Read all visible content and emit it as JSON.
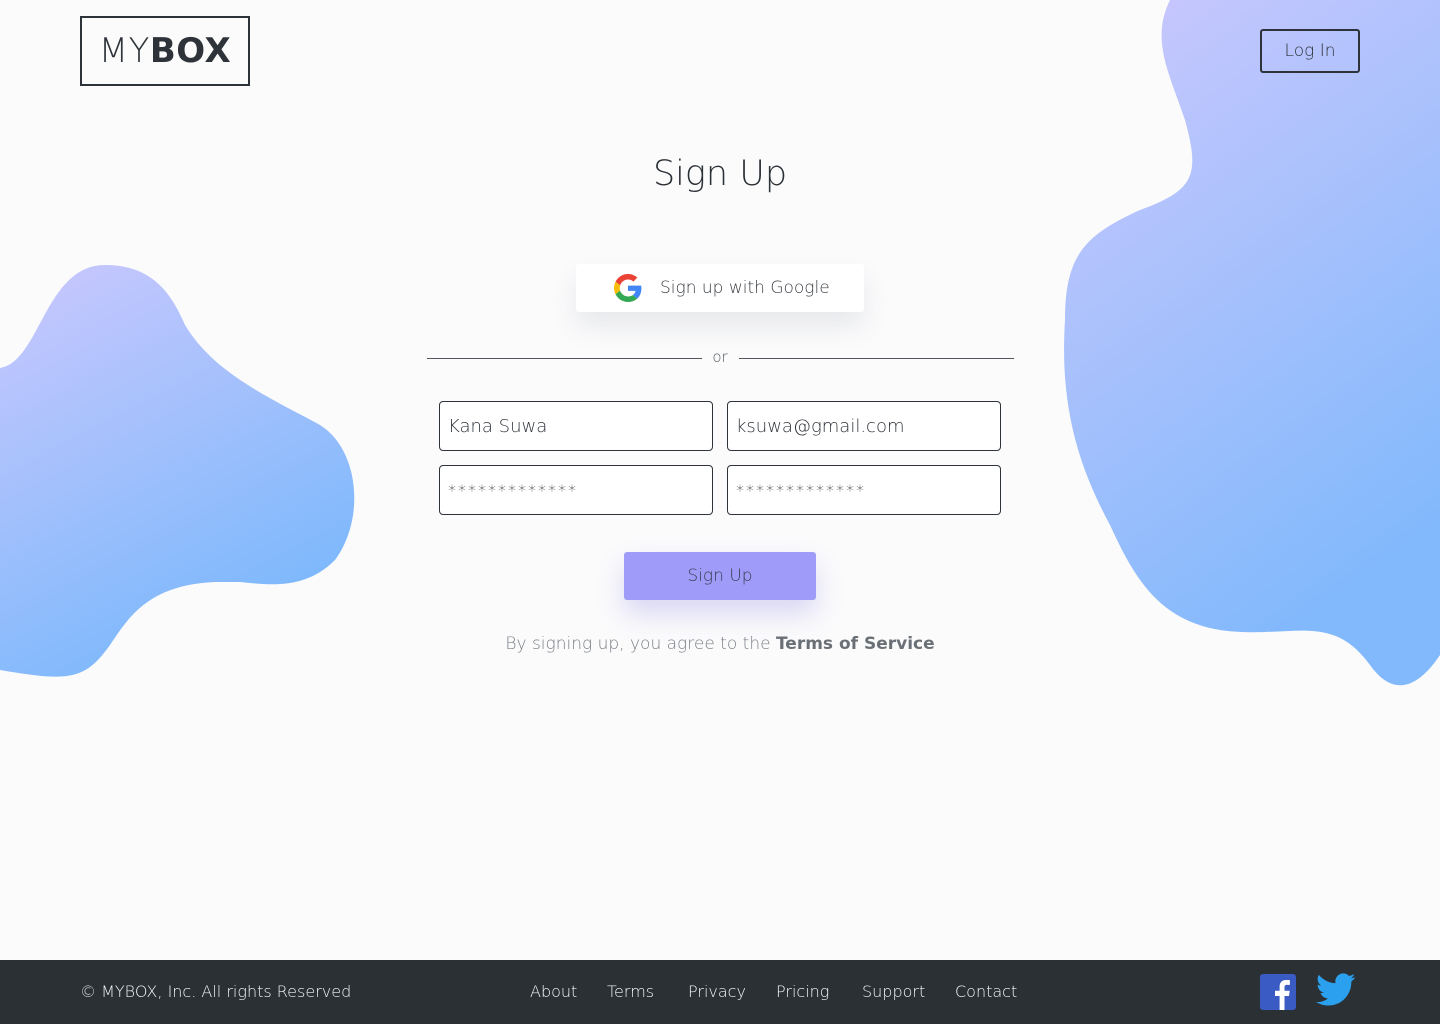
{
  "brand": {
    "logo_light": "MY",
    "logo_bold": "BOX"
  },
  "header": {
    "login_label": "Log In"
  },
  "signup": {
    "title": "Sign Up",
    "google_label": "Sign up with Google",
    "divider_text": "or",
    "name_value": "Kana Suwa",
    "email_value": "ksuwa@gmail.com",
    "password_value": "*************",
    "confirm_password_value": "*************",
    "submit_label": "Sign Up",
    "terms_prefix": "By signing up, you agree to the ",
    "terms_link": "Terms of Service"
  },
  "footer": {
    "copyright": "© MYBOX, Inc. All rights Reserved",
    "links": [
      "About",
      "Terms",
      "Privacy",
      "Pricing",
      "Support",
      "Contact"
    ],
    "social": [
      "facebook-icon",
      "twitter-icon"
    ]
  },
  "colors": {
    "accent": "#9f9cf9",
    "blob_top": "#cbc8fd",
    "blob_bottom": "#7fb8fc",
    "footer_bg": "#2b3034",
    "text": "#2b3036"
  }
}
